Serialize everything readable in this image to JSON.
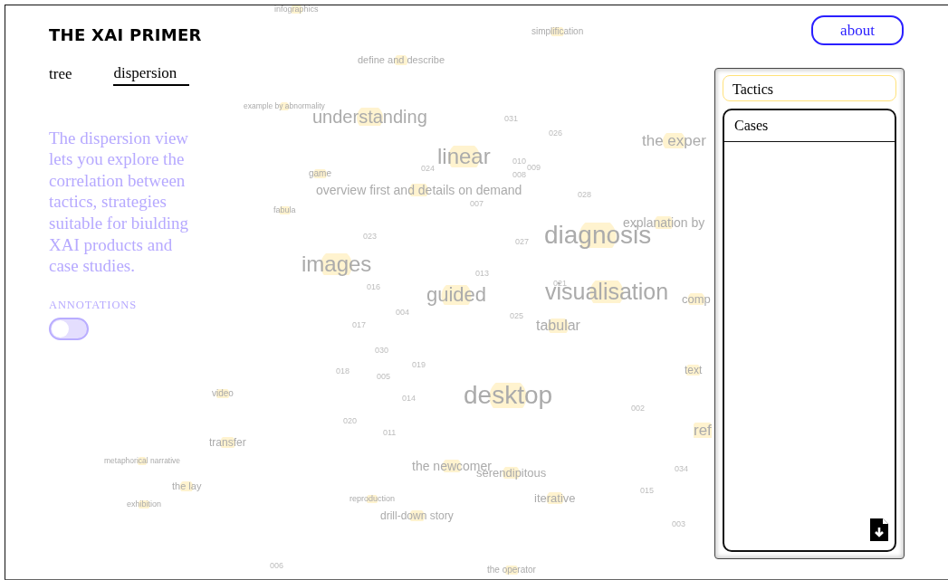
{
  "title": "THE XAI PRIMER",
  "about_button": "about",
  "tabs": [
    {
      "label": "tree",
      "selected": false
    },
    {
      "label": "dispersion",
      "selected": true
    }
  ],
  "description": "The dispersion view lets you explore the correlation between tactics, strategies suitable for biulding XAI products and case studies.",
  "annotations": {
    "label": "ANNOTATIONS",
    "on": false
  },
  "canvas_words": [
    {
      "text": "infographics",
      "kind": "term"
    },
    {
      "text": "simplification",
      "kind": "term"
    },
    {
      "text": "define and describe",
      "kind": "term"
    },
    {
      "text": "example by abnormality",
      "kind": "term"
    },
    {
      "text": "understanding",
      "kind": "term"
    },
    {
      "text": "031",
      "kind": "number"
    },
    {
      "text": "026",
      "kind": "number"
    },
    {
      "text": "the exper",
      "kind": "term"
    },
    {
      "text": "game",
      "kind": "term"
    },
    {
      "text": "024",
      "kind": "number"
    },
    {
      "text": "linear",
      "kind": "term"
    },
    {
      "text": "010",
      "kind": "number"
    },
    {
      "text": "009",
      "kind": "number"
    },
    {
      "text": "008",
      "kind": "number"
    },
    {
      "text": "overview first and details on demand",
      "kind": "term"
    },
    {
      "text": "028",
      "kind": "number"
    },
    {
      "text": "007",
      "kind": "number"
    },
    {
      "text": "fabula",
      "kind": "term"
    },
    {
      "text": "explanation by",
      "kind": "term"
    },
    {
      "text": "023",
      "kind": "number"
    },
    {
      "text": "027",
      "kind": "number"
    },
    {
      "text": "diagnosis",
      "kind": "term"
    },
    {
      "text": "images",
      "kind": "term"
    },
    {
      "text": "013",
      "kind": "number"
    },
    {
      "text": "016",
      "kind": "number"
    },
    {
      "text": "guided",
      "kind": "term"
    },
    {
      "text": "021",
      "kind": "number"
    },
    {
      "text": "visualisation",
      "kind": "term"
    },
    {
      "text": "comp",
      "kind": "term"
    },
    {
      "text": "004",
      "kind": "number"
    },
    {
      "text": "025",
      "kind": "number"
    },
    {
      "text": "017",
      "kind": "number"
    },
    {
      "text": "tabular",
      "kind": "term"
    },
    {
      "text": "030",
      "kind": "number"
    },
    {
      "text": "018",
      "kind": "number"
    },
    {
      "text": "019",
      "kind": "number"
    },
    {
      "text": "005",
      "kind": "number"
    },
    {
      "text": "text",
      "kind": "term"
    },
    {
      "text": "video",
      "kind": "term"
    },
    {
      "text": "014",
      "kind": "number"
    },
    {
      "text": "desktop",
      "kind": "term"
    },
    {
      "text": "002",
      "kind": "number"
    },
    {
      "text": "020",
      "kind": "number"
    },
    {
      "text": "011",
      "kind": "number"
    },
    {
      "text": "ref",
      "kind": "term"
    },
    {
      "text": "transfer",
      "kind": "term"
    },
    {
      "text": "metaphorical narrative",
      "kind": "term"
    },
    {
      "text": "the newcomer",
      "kind": "term"
    },
    {
      "text": "serendipitous",
      "kind": "term"
    },
    {
      "text": "034",
      "kind": "number"
    },
    {
      "text": "the lay",
      "kind": "term"
    },
    {
      "text": "015",
      "kind": "number"
    },
    {
      "text": "exhibition",
      "kind": "term"
    },
    {
      "text": "reproduction",
      "kind": "term"
    },
    {
      "text": "iterative",
      "kind": "term"
    },
    {
      "text": "drill-down story",
      "kind": "term"
    },
    {
      "text": "003",
      "kind": "number"
    },
    {
      "text": "006",
      "kind": "number"
    },
    {
      "text": "the operator",
      "kind": "term"
    }
  ],
  "panel": {
    "tactics": "Tactics",
    "cases": "Cases"
  }
}
